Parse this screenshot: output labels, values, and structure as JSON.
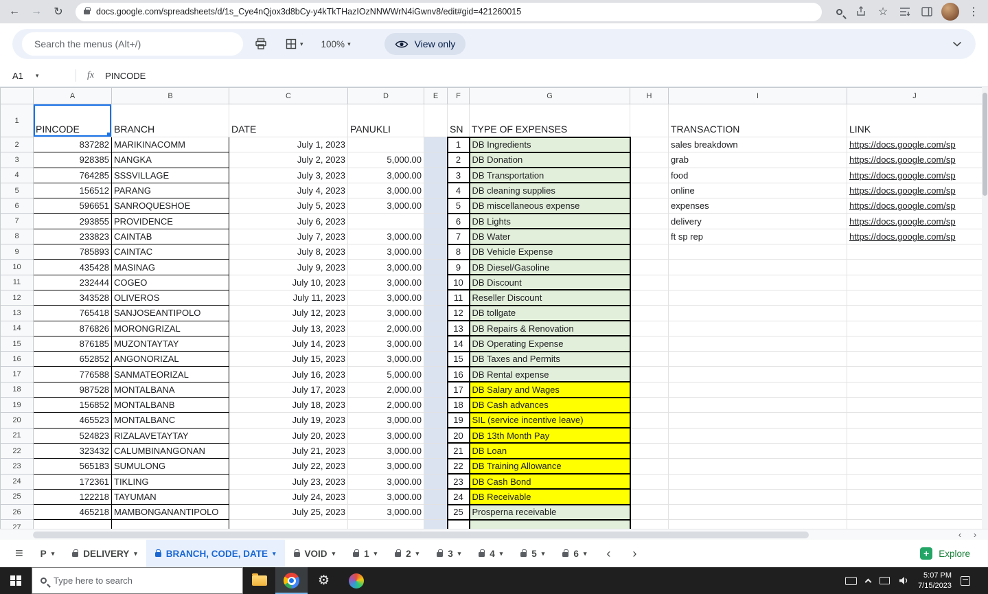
{
  "browser": {
    "url": "docs.google.com/spreadsheets/d/1s_Cye4nQjox3d8bCy-y4kTkTHazIOzNNWWrN4iGwnv8/edit#gid=421260015"
  },
  "icons": {
    "back": "←",
    "forward": "→",
    "reload": "↻",
    "star": "☆",
    "menu_dots": "⋮",
    "caret_down": "▾",
    "hamburger": "≡",
    "chevron_left": "‹",
    "chevron_right": "›",
    "gear": "⚙",
    "explore_plus": "+"
  },
  "menu_toolbar": {
    "search_placeholder": "Search the menus (Alt+/)",
    "zoom_value": "100%",
    "view_only_label": "View only"
  },
  "formula_bar": {
    "cell_ref": "A1",
    "fx_label": "fx",
    "value": "PINCODE"
  },
  "sheet": {
    "column_letters": [
      "A",
      "B",
      "C",
      "D",
      "E",
      "F",
      "G",
      "H",
      "I",
      "J"
    ],
    "headers": {
      "pincode": "PINCODE",
      "branch": "BRANCH",
      "date": "DATE",
      "panukli": "PANUKLI",
      "sn": "SN",
      "expenses": "TYPE OF EXPENSES",
      "transaction": "TRANSACTION",
      "link": "LINK"
    },
    "link_text": "https://docs.google.com/sp",
    "rows": [
      {
        "n": "2",
        "pincode": "837282",
        "branch": "MARIKINACOMM",
        "date": "July 1, 2023",
        "panukli": "",
        "sn": "1",
        "expense": "DB Ingredients",
        "hl": "green",
        "transaction": "sales breakdown",
        "link": true
      },
      {
        "n": "3",
        "pincode": "928385",
        "branch": "NANGKA",
        "date": "July 2, 2023",
        "panukli": "5,000.00",
        "sn": "2",
        "expense": "DB Donation",
        "hl": "green",
        "transaction": "grab",
        "link": true
      },
      {
        "n": "4",
        "pincode": "764285",
        "branch": "SSSVILLAGE",
        "date": "July 3, 2023",
        "panukli": "3,000.00",
        "sn": "3",
        "expense": "DB Transportation",
        "hl": "green",
        "transaction": "food",
        "link": true
      },
      {
        "n": "5",
        "pincode": "156512",
        "branch": "PARANG",
        "date": "July 4, 2023",
        "panukli": "3,000.00",
        "sn": "4",
        "expense": "DB cleaning supplies",
        "hl": "green",
        "transaction": "online",
        "link": true
      },
      {
        "n": "6",
        "pincode": "596651",
        "branch": "SANROQUESHOE",
        "date": "July 5, 2023",
        "panukli": "3,000.00",
        "sn": "5",
        "expense": "DB miscellaneous expense",
        "hl": "green",
        "transaction": "expenses",
        "link": true
      },
      {
        "n": "7",
        "pincode": "293855",
        "branch": "PROVIDENCE",
        "date": "July 6, 2023",
        "panukli": "",
        "sn": "6",
        "expense": "DB Lights",
        "hl": "green",
        "transaction": "delivery",
        "link": true
      },
      {
        "n": "8",
        "pincode": "233823",
        "branch": "CAINTAB",
        "date": "July 7, 2023",
        "panukli": "3,000.00",
        "sn": "7",
        "expense": "DB Water",
        "hl": "green",
        "transaction": "ft sp rep",
        "link": true
      },
      {
        "n": "9",
        "pincode": "785893",
        "branch": "CAINTAC",
        "date": "July 8, 2023",
        "panukli": "3,000.00",
        "sn": "8",
        "expense": "DB Vehicle Expense",
        "hl": "green",
        "transaction": "",
        "link": false
      },
      {
        "n": "10",
        "pincode": "435428",
        "branch": "MASINAG",
        "date": "July 9, 2023",
        "panukli": "3,000.00",
        "sn": "9",
        "expense": "DB Diesel/Gasoline",
        "hl": "green",
        "transaction": "",
        "link": false
      },
      {
        "n": "11",
        "pincode": "232444",
        "branch": "COGEO",
        "date": "July 10, 2023",
        "panukli": "3,000.00",
        "sn": "10",
        "expense": "DB Discount",
        "hl": "green",
        "transaction": "",
        "link": false
      },
      {
        "n": "12",
        "pincode": "343528",
        "branch": "OLIVEROS",
        "date": "July 11, 2023",
        "panukli": "3,000.00",
        "sn": "11",
        "expense": "Reseller Discount",
        "hl": "green",
        "transaction": "",
        "link": false
      },
      {
        "n": "13",
        "pincode": "765418",
        "branch": "SANJOSEANTIPOLO",
        "date": "July 12, 2023",
        "panukli": "3,000.00",
        "sn": "12",
        "expense": "DB tollgate",
        "hl": "green",
        "transaction": "",
        "link": false
      },
      {
        "n": "14",
        "pincode": "876826",
        "branch": "MORONGRIZAL",
        "date": "July 13, 2023",
        "panukli": "2,000.00",
        "sn": "13",
        "expense": "DB Repairs & Renovation",
        "hl": "green",
        "transaction": "",
        "link": false
      },
      {
        "n": "15",
        "pincode": "876185",
        "branch": "MUZONTAYTAY",
        "date": "July 14, 2023",
        "panukli": "3,000.00",
        "sn": "14",
        "expense": "DB Operating Expense",
        "hl": "green",
        "transaction": "",
        "link": false
      },
      {
        "n": "16",
        "pincode": "652852",
        "branch": "ANGONORIZAL",
        "date": "July 15, 2023",
        "panukli": "3,000.00",
        "sn": "15",
        "expense": "DB Taxes and Permits",
        "hl": "green",
        "transaction": "",
        "link": false
      },
      {
        "n": "17",
        "pincode": "776588",
        "branch": "SANMATEORIZAL",
        "date": "July 16, 2023",
        "panukli": "5,000.00",
        "sn": "16",
        "expense": "DB Rental expense",
        "hl": "green",
        "transaction": "",
        "link": false
      },
      {
        "n": "18",
        "pincode": "987528",
        "branch": "MONTALBANA",
        "date": "July 17, 2023",
        "panukli": "2,000.00",
        "sn": "17",
        "expense": "DB Salary and Wages",
        "hl": "yellow",
        "transaction": "",
        "link": false
      },
      {
        "n": "19",
        "pincode": "156852",
        "branch": "MONTALBANB",
        "date": "July 18, 2023",
        "panukli": "2,000.00",
        "sn": "18",
        "expense": "DB Cash advances",
        "hl": "yellow",
        "transaction": "",
        "link": false
      },
      {
        "n": "20",
        "pincode": "465523",
        "branch": "MONTALBANC",
        "date": "July 19, 2023",
        "panukli": "3,000.00",
        "sn": "19",
        "expense": "SIL (service incentive leave)",
        "hl": "yellow",
        "transaction": "",
        "link": false
      },
      {
        "n": "21",
        "pincode": "524823",
        "branch": "RIZALAVETAYTAY",
        "date": "July 20, 2023",
        "panukli": "3,000.00",
        "sn": "20",
        "expense": "DB 13th Month Pay",
        "hl": "yellow",
        "transaction": "",
        "link": false
      },
      {
        "n": "22",
        "pincode": "323432",
        "branch": "CALUMBINANGONAN",
        "date": "July 21, 2023",
        "panukli": "3,000.00",
        "sn": "21",
        "expense": "DB Loan",
        "hl": "yellow",
        "transaction": "",
        "link": false
      },
      {
        "n": "23",
        "pincode": "565183",
        "branch": "SUMULONG",
        "date": "July 22, 2023",
        "panukli": "3,000.00",
        "sn": "22",
        "expense": "DB Training Allowance",
        "hl": "yellow",
        "transaction": "",
        "link": false
      },
      {
        "n": "24",
        "pincode": "172361",
        "branch": "TIKLING",
        "date": "July 23, 2023",
        "panukli": "3,000.00",
        "sn": "23",
        "expense": "DB Cash Bond",
        "hl": "yellow",
        "transaction": "",
        "link": false
      },
      {
        "n": "25",
        "pincode": "122218",
        "branch": "TAYUMAN",
        "date": "July 24, 2023",
        "panukli": "3,000.00",
        "sn": "24",
        "expense": "DB Receivable",
        "hl": "yellow",
        "transaction": "",
        "link": false
      },
      {
        "n": "26",
        "pincode": "465218",
        "branch": "MAMBONGANANTIPOLO",
        "date": "July 25, 2023",
        "panukli": "3,000.00",
        "sn": "25",
        "expense": "Prosperna receivable",
        "hl": "green",
        "transaction": "",
        "link": false
      },
      {
        "n": "27",
        "pincode": "",
        "branch": "",
        "date": "",
        "panukli": "",
        "sn": "",
        "expense": "",
        "hl": "green",
        "transaction": "",
        "link": false
      }
    ]
  },
  "tabs_bar": {
    "tabs": [
      {
        "label": "P",
        "locked": false,
        "active": false
      },
      {
        "label": "DELIVERY",
        "locked": true,
        "active": false
      },
      {
        "label": "BRANCH, CODE, DATE",
        "locked": true,
        "active": true
      },
      {
        "label": "VOID",
        "locked": true,
        "active": false
      },
      {
        "label": "1",
        "locked": true,
        "active": false
      },
      {
        "label": "2",
        "locked": true,
        "active": false
      },
      {
        "label": "3",
        "locked": true,
        "active": false
      },
      {
        "label": "4",
        "locked": true,
        "active": false
      },
      {
        "label": "5",
        "locked": true,
        "active": false
      },
      {
        "label": "6",
        "locked": true,
        "active": false
      }
    ],
    "explore_label": "Explore"
  },
  "taskbar": {
    "search_placeholder": "Type here to search",
    "time": "5:07 PM",
    "date": "7/15/2023"
  }
}
